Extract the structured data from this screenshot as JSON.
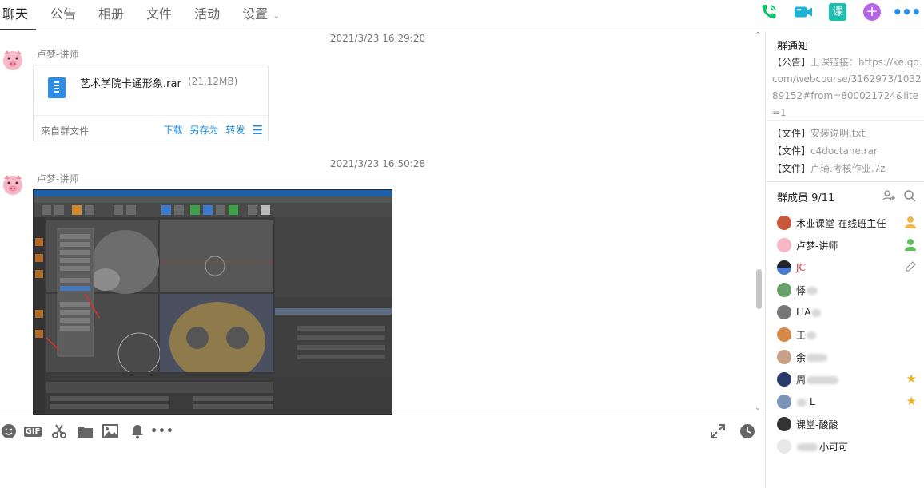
{
  "tabs": [
    "聊天",
    "公告",
    "相册",
    "文件",
    "活动",
    "设置"
  ],
  "top_actions": {
    "ke_label": "课",
    "plus_label": "+",
    "more_label": "•••"
  },
  "messages": [
    {
      "time": "2021/3/23 16:29:20",
      "sender": "卢梦-讲师",
      "file": {
        "name": "艺术学院卡通形象.rar",
        "size": "(21.12MB)",
        "source": "来自群文件",
        "actions": [
          "下载",
          "另存为",
          "转发"
        ]
      }
    },
    {
      "time": "2021/3/23 16:50:28",
      "sender": "卢梦-讲师"
    }
  ],
  "side": {
    "notice_title": "群通知",
    "notice_tag": "【公告】",
    "notice_text": "上课链接：https://ke.qq.com/webcourse/3162973/103289152#from=800021724&lite=1",
    "files": [
      {
        "tag": "【文件】",
        "name": "安装说明.txt"
      },
      {
        "tag": "【文件】",
        "name": "c4doctane.rar"
      },
      {
        "tag": "【文件】",
        "name": "卢琦.考核作业.7z"
      }
    ],
    "member_title": "群成员 9/11",
    "members": [
      {
        "name": "术业课堂-在线班主任",
        "badge": "owner"
      },
      {
        "name": "卢梦-讲师",
        "badge": "admin"
      },
      {
        "name": "JC",
        "badge": "edit",
        "red": true
      },
      {
        "name": "悸",
        "badge": ""
      },
      {
        "name": "LIA",
        "badge": ""
      },
      {
        "name": "王",
        "badge": ""
      },
      {
        "name": "余",
        "badge": ""
      },
      {
        "name": "周",
        "badge": "star"
      },
      {
        "name": "L",
        "badge": "star"
      },
      {
        "name": "课堂-酸酸",
        "badge": ""
      },
      {
        "name": "小可可",
        "badge": ""
      }
    ]
  },
  "colors": {
    "accent": "#1e8ee6",
    "green": "#15c06a",
    "teal": "#1bc0b0",
    "purple": "#b467e9"
  }
}
